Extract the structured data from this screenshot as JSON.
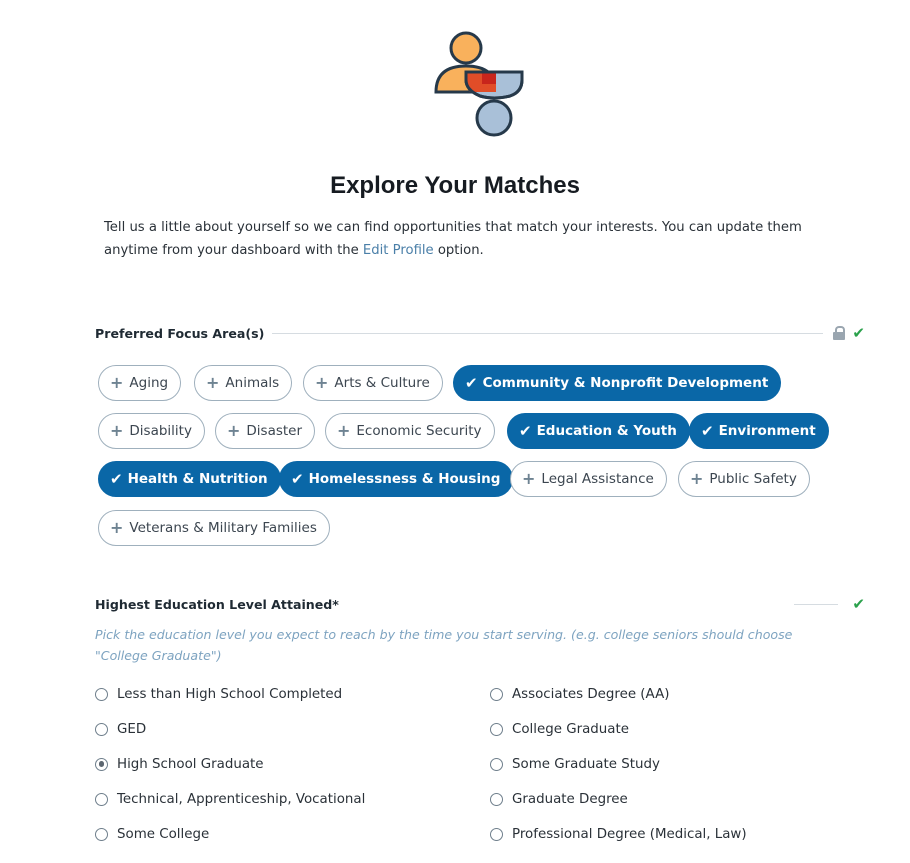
{
  "page": {
    "title": "Explore Your Matches",
    "intro_before": "Tell us a little about yourself so we can find opportunities that match your interests. You can update them anytime from your dashboard with the ",
    "intro_link": "Edit Profile",
    "intro_after": " option."
  },
  "focus": {
    "label": "Preferred Focus Area(s)",
    "chips": [
      {
        "label": "Aging",
        "selected": false
      },
      {
        "label": "Animals",
        "selected": false
      },
      {
        "label": "Arts & Culture",
        "selected": false
      },
      {
        "label": "Community & Nonprofit Development",
        "selected": true
      },
      {
        "label": "Disability",
        "selected": false
      },
      {
        "label": "Disaster",
        "selected": false
      },
      {
        "label": "Economic Security",
        "selected": false
      },
      {
        "label": "Education & Youth",
        "selected": true
      },
      {
        "label": "Environment",
        "selected": true
      },
      {
        "label": "Health & Nutrition",
        "selected": true
      },
      {
        "label": "Homelessness & Housing",
        "selected": true
      },
      {
        "label": "Legal Assistance",
        "selected": false
      },
      {
        "label": "Public Safety",
        "selected": false
      },
      {
        "label": "Veterans & Military Families",
        "selected": false
      }
    ]
  },
  "education": {
    "label": "Highest Education Level Attained*",
    "hint": "Pick the education level you expect to reach by the time you start serving. (e.g. college seniors should choose \"College Graduate\")",
    "selected": "High School Graduate",
    "options_left": [
      "Less than High School Completed",
      "GED",
      "High School Graduate",
      "Technical, Apprenticeship, Vocational",
      "Some College"
    ],
    "options_right": [
      "Associates Degree (AA)",
      "College Graduate",
      "Some Graduate Study",
      "Graduate Degree",
      "Professional Degree (Medical, Law)"
    ]
  },
  "colors": {
    "accent": "#0a67a7",
    "check": "#2aa14b",
    "link": "#4a7fa8",
    "hint": "#7da3c0"
  }
}
